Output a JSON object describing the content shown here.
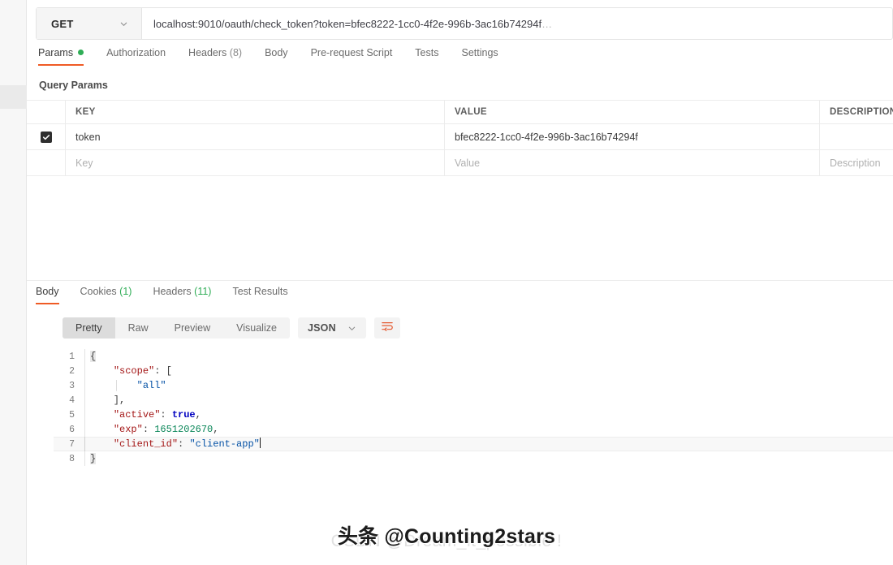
{
  "left_rail": {
    "active_item": ""
  },
  "request": {
    "method": "GET",
    "method_chevron_icon": "chevron-down-icon",
    "url": "localhost:9010/oauth/check_token?token=bfec8222-1cc0-4f2e-996b-3ac16b74294f",
    "url_ellipsis": "…",
    "tabs": [
      {
        "label": "Params",
        "badge": "",
        "has_dot": true,
        "active": true
      },
      {
        "label": "Authorization",
        "badge": "",
        "has_dot": false,
        "active": false
      },
      {
        "label": "Headers",
        "badge": "(8)",
        "has_dot": false,
        "active": false
      },
      {
        "label": "Body",
        "badge": "",
        "has_dot": false,
        "active": false
      },
      {
        "label": "Pre-request Script",
        "badge": "",
        "has_dot": false,
        "active": false
      },
      {
        "label": "Tests",
        "badge": "",
        "has_dot": false,
        "active": false
      },
      {
        "label": "Settings",
        "badge": "",
        "has_dot": false,
        "active": false
      }
    ]
  },
  "query_params": {
    "title": "Query Params",
    "columns": [
      "KEY",
      "VALUE",
      "DESCRIPTION"
    ],
    "rows": [
      {
        "checked": true,
        "key": "token",
        "value": "bfec8222-1cc0-4f2e-996b-3ac16b74294f",
        "description": ""
      }
    ],
    "placeholder_row": {
      "key": "Key",
      "value": "Value",
      "description": "Description"
    }
  },
  "response": {
    "tabs": [
      {
        "label": "Body",
        "badge": "",
        "active": true
      },
      {
        "label": "Cookies",
        "badge": "(1)",
        "active": false
      },
      {
        "label": "Headers",
        "badge": "(11)",
        "active": false
      },
      {
        "label": "Test Results",
        "badge": "",
        "active": false
      }
    ],
    "view_modes": [
      {
        "label": "Pretty",
        "active": true
      },
      {
        "label": "Raw",
        "active": false
      },
      {
        "label": "Preview",
        "active": false
      },
      {
        "label": "Visualize",
        "active": false
      }
    ],
    "format": "JSON",
    "format_chevron_icon": "chevron-down-icon",
    "wrap_icon": "word-wrap-icon",
    "active_line": 7,
    "body_lines": [
      {
        "n": "1",
        "segments": [
          {
            "t": "{",
            "c": "brace"
          }
        ]
      },
      {
        "n": "2",
        "segments": [
          {
            "t": "    ",
            "c": "punc"
          },
          {
            "t": "\"scope\"",
            "c": "key"
          },
          {
            "t": ": [",
            "c": "punc"
          }
        ]
      },
      {
        "n": "3",
        "segments": [
          {
            "t": "    ",
            "c": "punc"
          },
          {
            "t": "|   ",
            "c": "guide"
          },
          {
            "t": "\"all\"",
            "c": "str"
          }
        ]
      },
      {
        "n": "4",
        "segments": [
          {
            "t": "    ",
            "c": "punc"
          },
          {
            "t": "],",
            "c": "punc"
          }
        ]
      },
      {
        "n": "5",
        "segments": [
          {
            "t": "    ",
            "c": "punc"
          },
          {
            "t": "\"active\"",
            "c": "key"
          },
          {
            "t": ": ",
            "c": "punc"
          },
          {
            "t": "true",
            "c": "bool"
          },
          {
            "t": ",",
            "c": "punc"
          }
        ]
      },
      {
        "n": "6",
        "segments": [
          {
            "t": "    ",
            "c": "punc"
          },
          {
            "t": "\"exp\"",
            "c": "key"
          },
          {
            "t": ": ",
            "c": "punc"
          },
          {
            "t": "1651202670",
            "c": "num"
          },
          {
            "t": ",",
            "c": "punc"
          }
        ]
      },
      {
        "n": "7",
        "segments": [
          {
            "t": "    ",
            "c": "punc"
          },
          {
            "t": "\"client_id\"",
            "c": "key"
          },
          {
            "t": ": ",
            "c": "punc"
          },
          {
            "t": "\"client-app\"",
            "c": "str"
          }
        ]
      },
      {
        "n": "8",
        "segments": [
          {
            "t": "}",
            "c": "brace"
          }
        ]
      }
    ]
  },
  "watermarks": {
    "back": "CSDN @Dream_it_possible !",
    "front": "头条 @Counting2stars"
  }
}
